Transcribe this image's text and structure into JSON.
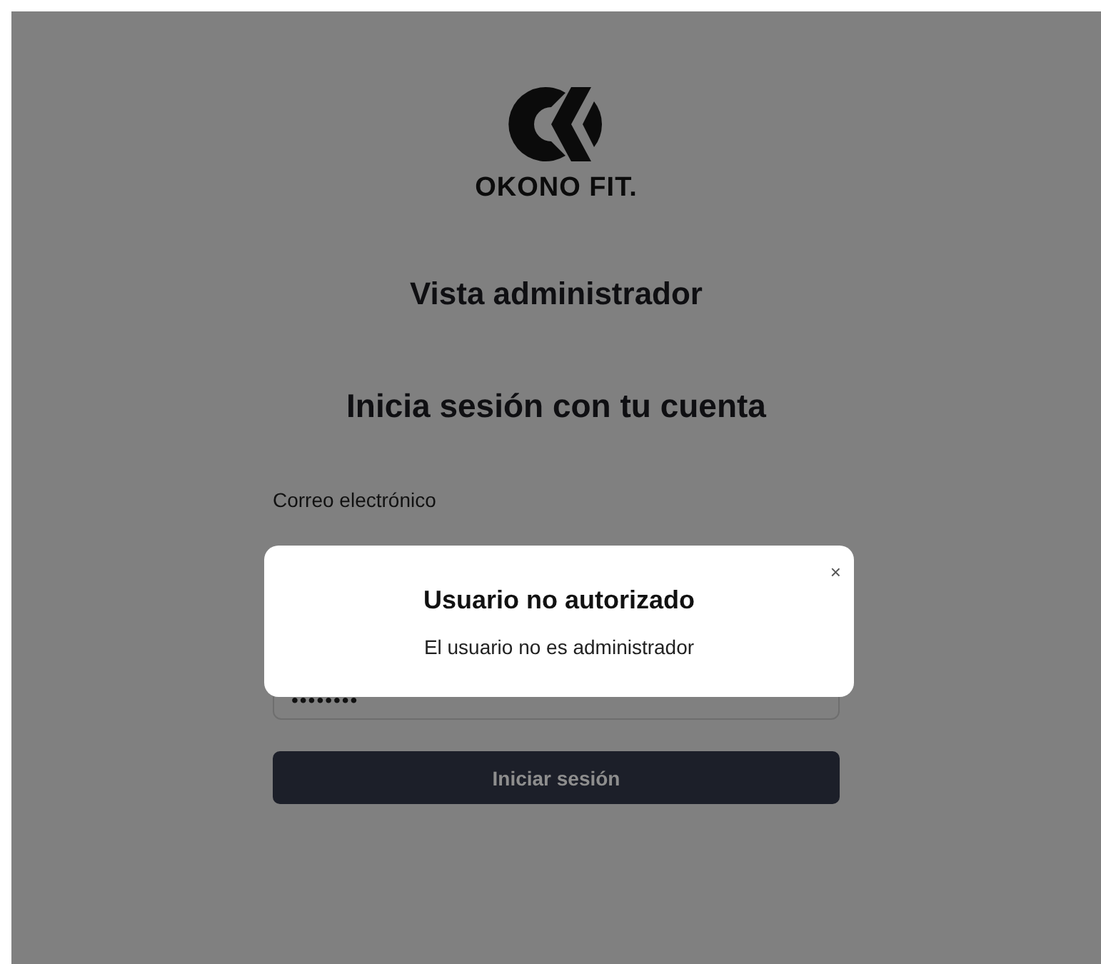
{
  "logo": {
    "brand": "OKONO FIT."
  },
  "title": "Vista administrador",
  "subtitle": "Inicia sesión con tu cuenta",
  "form": {
    "email_label": "Correo electrónico",
    "password_value": "••••••••",
    "submit": "Iniciar sesión"
  },
  "dialog": {
    "title": "Usuario no autorizado",
    "message": "El usuario no es administrador",
    "close": "×"
  }
}
